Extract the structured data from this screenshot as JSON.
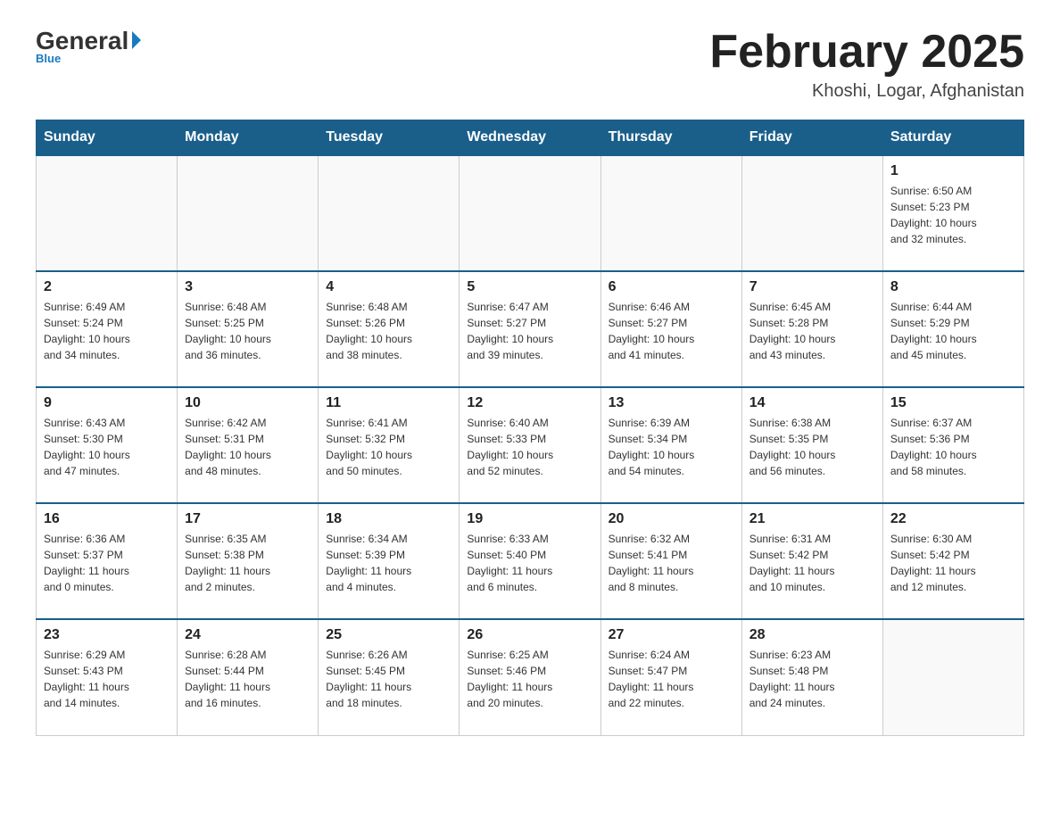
{
  "header": {
    "logo": {
      "general": "General",
      "blue": "Blue",
      "tagline": "Blue"
    },
    "title": "February 2025",
    "subtitle": "Khoshi, Logar, Afghanistan"
  },
  "days_of_week": [
    "Sunday",
    "Monday",
    "Tuesday",
    "Wednesday",
    "Thursday",
    "Friday",
    "Saturday"
  ],
  "weeks": [
    [
      {
        "day": "",
        "info": ""
      },
      {
        "day": "",
        "info": ""
      },
      {
        "day": "",
        "info": ""
      },
      {
        "day": "",
        "info": ""
      },
      {
        "day": "",
        "info": ""
      },
      {
        "day": "",
        "info": ""
      },
      {
        "day": "1",
        "info": "Sunrise: 6:50 AM\nSunset: 5:23 PM\nDaylight: 10 hours\nand 32 minutes."
      }
    ],
    [
      {
        "day": "2",
        "info": "Sunrise: 6:49 AM\nSunset: 5:24 PM\nDaylight: 10 hours\nand 34 minutes."
      },
      {
        "day": "3",
        "info": "Sunrise: 6:48 AM\nSunset: 5:25 PM\nDaylight: 10 hours\nand 36 minutes."
      },
      {
        "day": "4",
        "info": "Sunrise: 6:48 AM\nSunset: 5:26 PM\nDaylight: 10 hours\nand 38 minutes."
      },
      {
        "day": "5",
        "info": "Sunrise: 6:47 AM\nSunset: 5:27 PM\nDaylight: 10 hours\nand 39 minutes."
      },
      {
        "day": "6",
        "info": "Sunrise: 6:46 AM\nSunset: 5:27 PM\nDaylight: 10 hours\nand 41 minutes."
      },
      {
        "day": "7",
        "info": "Sunrise: 6:45 AM\nSunset: 5:28 PM\nDaylight: 10 hours\nand 43 minutes."
      },
      {
        "day": "8",
        "info": "Sunrise: 6:44 AM\nSunset: 5:29 PM\nDaylight: 10 hours\nand 45 minutes."
      }
    ],
    [
      {
        "day": "9",
        "info": "Sunrise: 6:43 AM\nSunset: 5:30 PM\nDaylight: 10 hours\nand 47 minutes."
      },
      {
        "day": "10",
        "info": "Sunrise: 6:42 AM\nSunset: 5:31 PM\nDaylight: 10 hours\nand 48 minutes."
      },
      {
        "day": "11",
        "info": "Sunrise: 6:41 AM\nSunset: 5:32 PM\nDaylight: 10 hours\nand 50 minutes."
      },
      {
        "day": "12",
        "info": "Sunrise: 6:40 AM\nSunset: 5:33 PM\nDaylight: 10 hours\nand 52 minutes."
      },
      {
        "day": "13",
        "info": "Sunrise: 6:39 AM\nSunset: 5:34 PM\nDaylight: 10 hours\nand 54 minutes."
      },
      {
        "day": "14",
        "info": "Sunrise: 6:38 AM\nSunset: 5:35 PM\nDaylight: 10 hours\nand 56 minutes."
      },
      {
        "day": "15",
        "info": "Sunrise: 6:37 AM\nSunset: 5:36 PM\nDaylight: 10 hours\nand 58 minutes."
      }
    ],
    [
      {
        "day": "16",
        "info": "Sunrise: 6:36 AM\nSunset: 5:37 PM\nDaylight: 11 hours\nand 0 minutes."
      },
      {
        "day": "17",
        "info": "Sunrise: 6:35 AM\nSunset: 5:38 PM\nDaylight: 11 hours\nand 2 minutes."
      },
      {
        "day": "18",
        "info": "Sunrise: 6:34 AM\nSunset: 5:39 PM\nDaylight: 11 hours\nand 4 minutes."
      },
      {
        "day": "19",
        "info": "Sunrise: 6:33 AM\nSunset: 5:40 PM\nDaylight: 11 hours\nand 6 minutes."
      },
      {
        "day": "20",
        "info": "Sunrise: 6:32 AM\nSunset: 5:41 PM\nDaylight: 11 hours\nand 8 minutes."
      },
      {
        "day": "21",
        "info": "Sunrise: 6:31 AM\nSunset: 5:42 PM\nDaylight: 11 hours\nand 10 minutes."
      },
      {
        "day": "22",
        "info": "Sunrise: 6:30 AM\nSunset: 5:42 PM\nDaylight: 11 hours\nand 12 minutes."
      }
    ],
    [
      {
        "day": "23",
        "info": "Sunrise: 6:29 AM\nSunset: 5:43 PM\nDaylight: 11 hours\nand 14 minutes."
      },
      {
        "day": "24",
        "info": "Sunrise: 6:28 AM\nSunset: 5:44 PM\nDaylight: 11 hours\nand 16 minutes."
      },
      {
        "day": "25",
        "info": "Sunrise: 6:26 AM\nSunset: 5:45 PM\nDaylight: 11 hours\nand 18 minutes."
      },
      {
        "day": "26",
        "info": "Sunrise: 6:25 AM\nSunset: 5:46 PM\nDaylight: 11 hours\nand 20 minutes."
      },
      {
        "day": "27",
        "info": "Sunrise: 6:24 AM\nSunset: 5:47 PM\nDaylight: 11 hours\nand 22 minutes."
      },
      {
        "day": "28",
        "info": "Sunrise: 6:23 AM\nSunset: 5:48 PM\nDaylight: 11 hours\nand 24 minutes."
      },
      {
        "day": "",
        "info": ""
      }
    ]
  ]
}
